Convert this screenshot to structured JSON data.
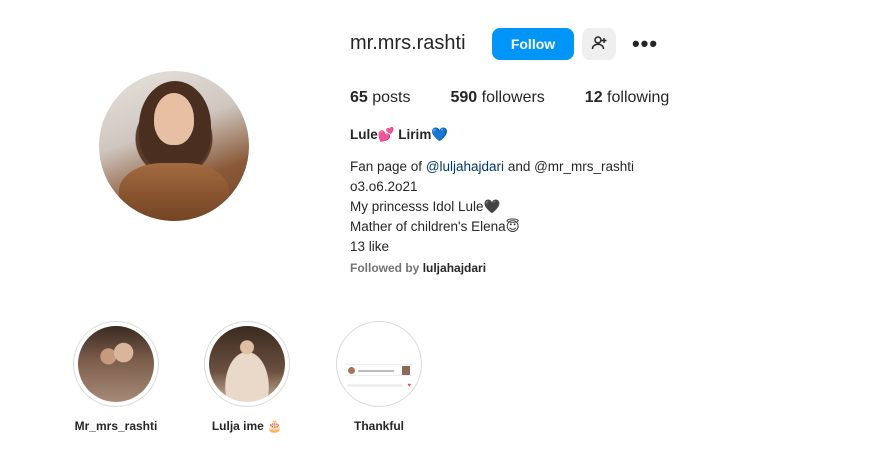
{
  "profile": {
    "username": "mr.mrs.rashti",
    "follow_label": "Follow",
    "suggest_icon": "add-person-icon",
    "more_icon": "more-horizontal-icon",
    "more_glyph": "•••",
    "stats": {
      "posts_count": "65",
      "posts_label": "posts",
      "followers_count": "590",
      "followers_label": "followers",
      "following_count": "12",
      "following_label": "following"
    },
    "display_name": "Lule💕 Lirim💙",
    "bio": {
      "line1_prefix": "Fan page of ",
      "mention1": "@luljahajdari",
      "line1_mid": " and ",
      "mention2": "@mr_mrs_rashti",
      "line2": "o3.o6.2o21",
      "line3": "My princesss Idol Lule🖤",
      "line4": "Mather of children's Elena😇",
      "line5": "13 like"
    },
    "followed_by_label": "Followed by",
    "followed_by_account": "luljahajdari"
  },
  "highlights": [
    {
      "label": "Mr_mrs_rashti"
    },
    {
      "label": "Lulja ime 🎂"
    },
    {
      "label": "Thankful"
    }
  ],
  "colors": {
    "accent": "#0095f6",
    "link": "#00376b",
    "secondary_text": "#737373"
  }
}
